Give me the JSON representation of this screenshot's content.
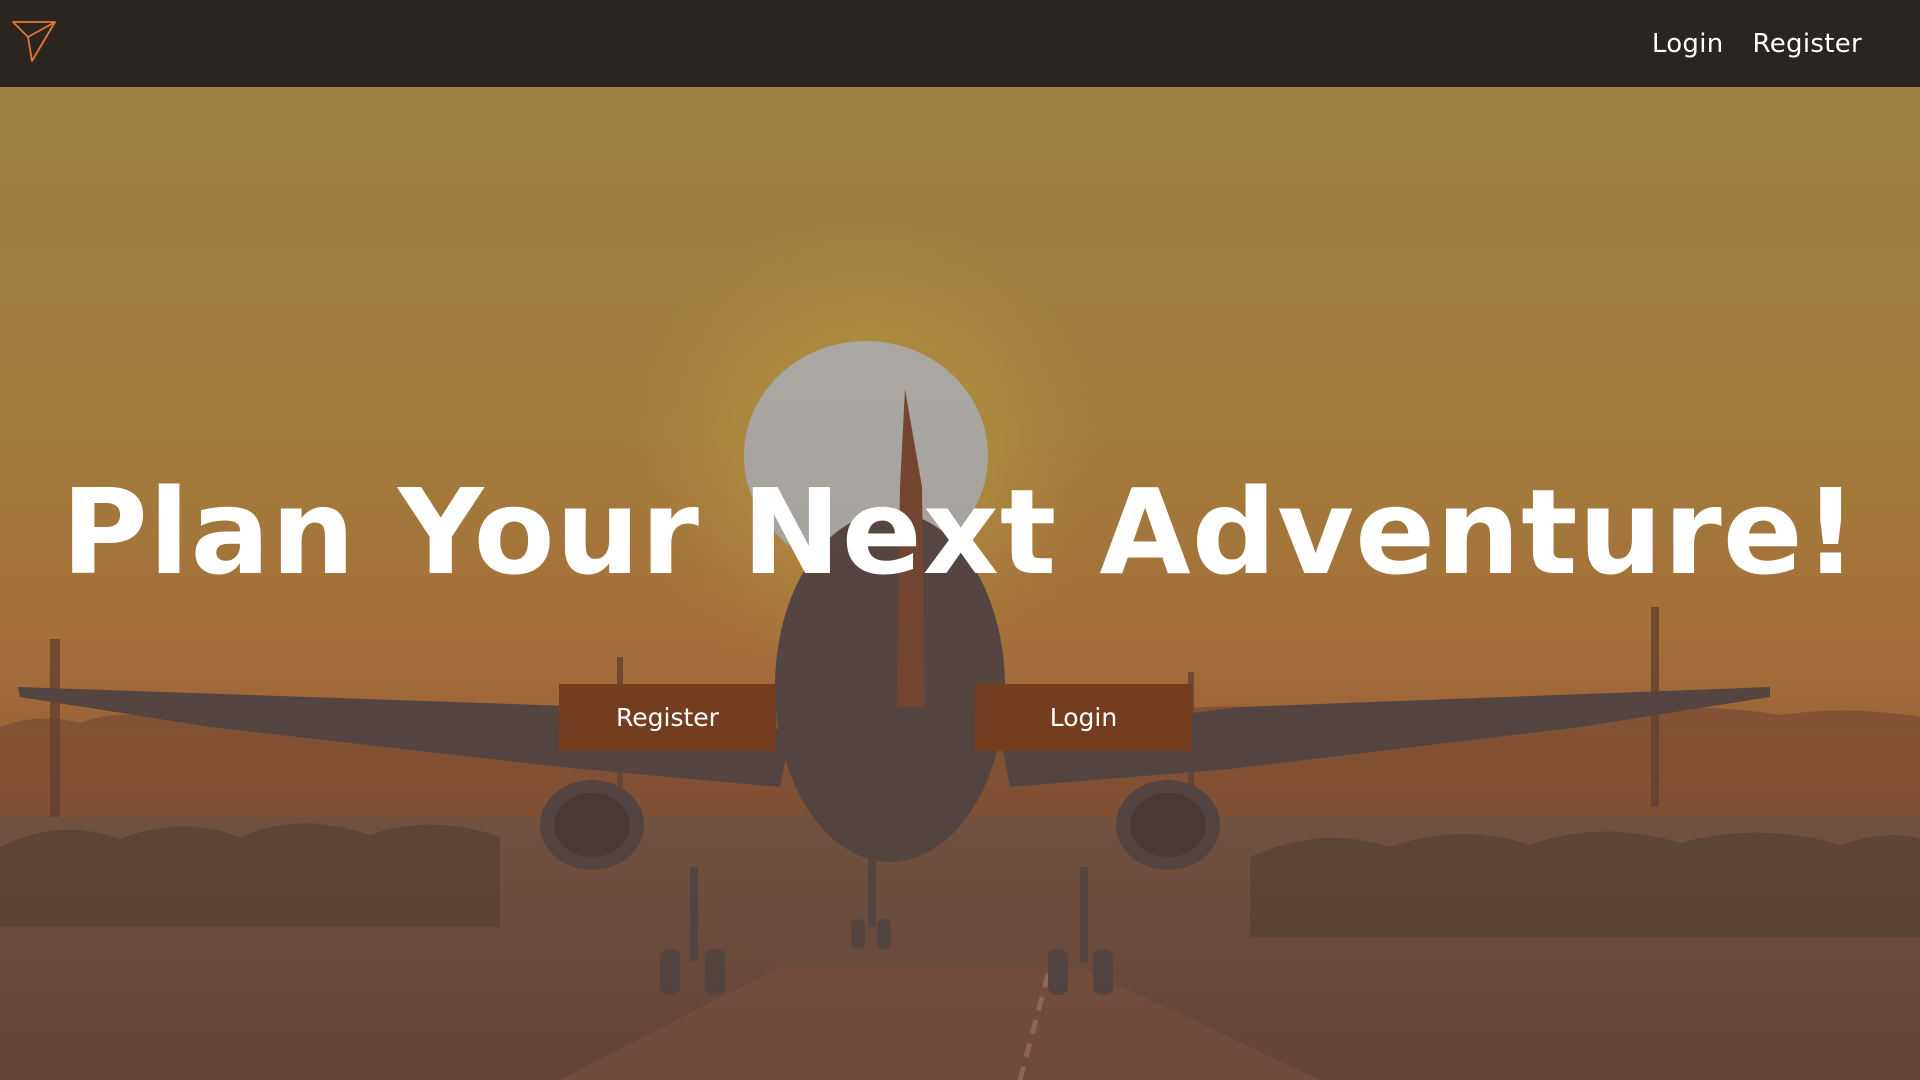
{
  "nav": {
    "logo_icon": "paper-plane-icon",
    "links": [
      {
        "label": "Login"
      },
      {
        "label": "Register"
      }
    ]
  },
  "hero": {
    "headline": "Plan Your Next Adventure!",
    "buttons": [
      {
        "label": "Register"
      },
      {
        "label": "Login"
      }
    ],
    "background": "airplane-landing-at-sunset"
  },
  "colors": {
    "navbar": "#2a2521",
    "button": "#743d20",
    "logo_accent": "#e8772e",
    "sky_top": "#a48646",
    "sky_bottom": "#b87546"
  }
}
